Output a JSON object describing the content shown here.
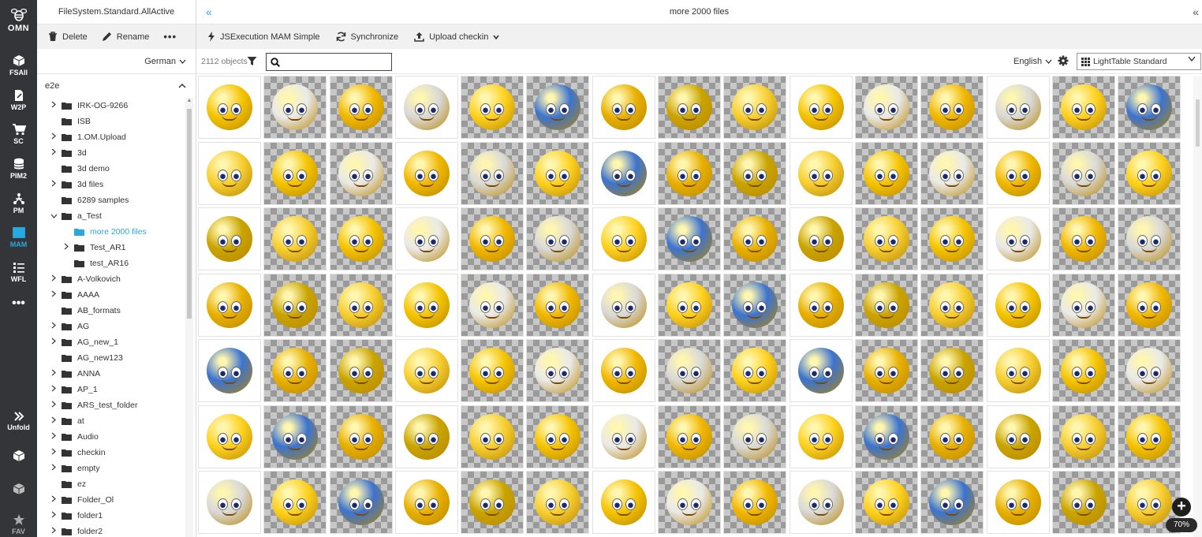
{
  "rail": {
    "logo": "OMN",
    "items": [
      {
        "label": "FSAll",
        "icon": "cube-icon"
      },
      {
        "label": "W2P",
        "icon": "document-edit-icon"
      },
      {
        "label": "SC",
        "icon": "cart-icon"
      },
      {
        "label": "PIM2",
        "icon": "database-icon"
      },
      {
        "label": "PM",
        "icon": "network-icon"
      },
      {
        "label": "MAM",
        "icon": "media-icon"
      },
      {
        "label": "WFL",
        "icon": "workflow-list-icon"
      }
    ],
    "unfold_label": "Unfold",
    "fav_label": "FAV"
  },
  "left_panel": {
    "title": "FileSystem.Standard.AllActive",
    "toolbar": {
      "delete": "Delete",
      "rename": "Rename"
    },
    "language": "German",
    "root": "e2e",
    "tree": [
      {
        "label": "IRK-OG-9266",
        "expandable": true,
        "depth": 0
      },
      {
        "label": "ISB",
        "expandable": false,
        "depth": 0
      },
      {
        "label": "1.OM.Upload",
        "expandable": true,
        "depth": 0
      },
      {
        "label": "3d",
        "expandable": true,
        "depth": 0
      },
      {
        "label": "3d demo",
        "expandable": false,
        "depth": 0
      },
      {
        "label": "3d files",
        "expandable": true,
        "depth": 0
      },
      {
        "label": "6289 samples",
        "expandable": false,
        "depth": 0
      },
      {
        "label": "a_Test",
        "expandable": true,
        "expanded": true,
        "depth": 0
      },
      {
        "label": "more 2000 files",
        "expandable": false,
        "depth": 1,
        "selected": true
      },
      {
        "label": "Test_AR1",
        "expandable": true,
        "depth": 1
      },
      {
        "label": "test_AR16",
        "expandable": false,
        "depth": 1
      },
      {
        "label": "A-Volkovich",
        "expandable": true,
        "depth": 0
      },
      {
        "label": "AAAA",
        "expandable": true,
        "depth": 0
      },
      {
        "label": "AB_formats",
        "expandable": false,
        "depth": 0
      },
      {
        "label": "AG",
        "expandable": true,
        "depth": 0
      },
      {
        "label": "AG_new_1",
        "expandable": true,
        "depth": 0
      },
      {
        "label": "AG_new123",
        "expandable": false,
        "depth": 0
      },
      {
        "label": "ANNA",
        "expandable": true,
        "depth": 0
      },
      {
        "label": "AP_1",
        "expandable": true,
        "depth": 0
      },
      {
        "label": "ARS_test_folder",
        "expandable": true,
        "depth": 0
      },
      {
        "label": "at",
        "expandable": true,
        "depth": 0
      },
      {
        "label": "Audio",
        "expandable": true,
        "depth": 0
      },
      {
        "label": "checkin",
        "expandable": true,
        "depth": 0
      },
      {
        "label": "empty",
        "expandable": true,
        "depth": 0
      },
      {
        "label": "ez",
        "expandable": false,
        "depth": 0
      },
      {
        "label": "Folder_Ol",
        "expandable": true,
        "depth": 0
      },
      {
        "label": "folder1",
        "expandable": true,
        "depth": 0
      },
      {
        "label": "folder2",
        "expandable": true,
        "depth": 0
      }
    ]
  },
  "main": {
    "title": "more 2000 files",
    "toolbar": {
      "jsexecution": "JSExecution MAM Simple",
      "synchronize": "Synchronize",
      "upload": "Upload checkin"
    },
    "object_count": "2112 objects",
    "search": {
      "value": "",
      "placeholder": ""
    },
    "language": "English",
    "view": "LightTable Standard",
    "zoom": "70%",
    "thumbnail_count": 105
  },
  "colors": {
    "accent": "#29a8e0",
    "rail_bg": "#333538",
    "toolbar_bg": "#f1f1f1"
  }
}
